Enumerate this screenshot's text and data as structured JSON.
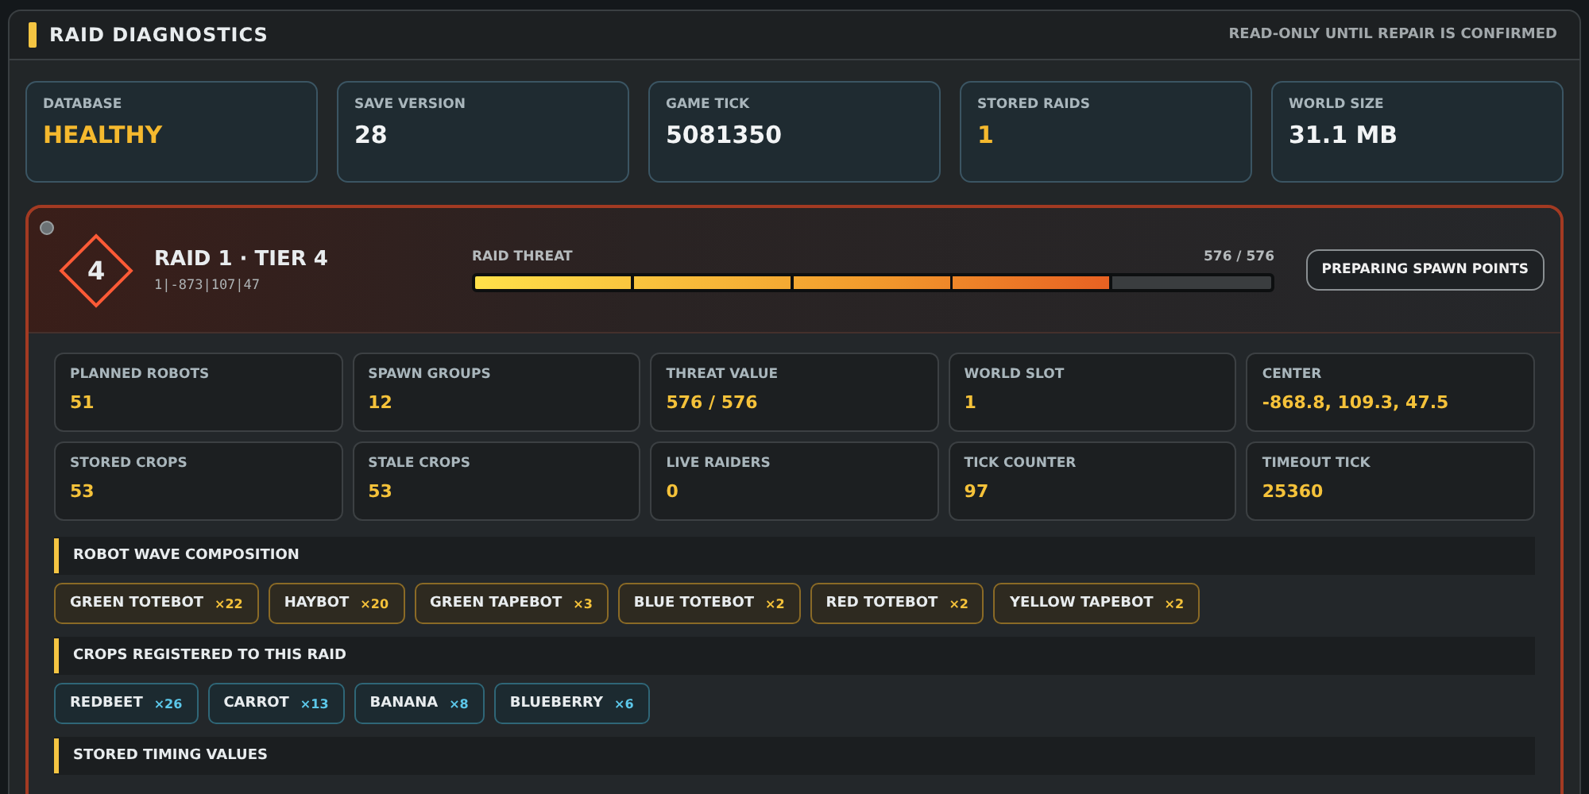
{
  "header": {
    "title": "RAID DIAGNOSTICS",
    "note": "READ-ONLY UNTIL REPAIR IS CONFIRMED"
  },
  "stats": [
    {
      "label": "DATABASE",
      "value": "HEALTHY",
      "highlight": true
    },
    {
      "label": "SAVE VERSION",
      "value": "28",
      "highlight": false
    },
    {
      "label": "GAME TICK",
      "value": "5081350",
      "highlight": false
    },
    {
      "label": "STORED RAIDS",
      "value": "1",
      "highlight": true
    },
    {
      "label": "WORLD SIZE",
      "value": "31.1 MB",
      "highlight": false
    }
  ],
  "raid": {
    "tier": "4",
    "title": "RAID 1 · TIER 4",
    "coords": "1|-873|107|47",
    "threat": {
      "label": "RAID THREAT",
      "reading": "576 / 576",
      "level": 0.8
    },
    "status": "PREPARING SPAWN POINTS",
    "stats": [
      {
        "label": "PLANNED ROBOTS",
        "value": "51"
      },
      {
        "label": "SPAWN GROUPS",
        "value": "12"
      },
      {
        "label": "THREAT VALUE",
        "value": "576 / 576"
      },
      {
        "label": "WORLD SLOT",
        "value": "1"
      },
      {
        "label": "CENTER",
        "value": "-868.8, 109.3, 47.5"
      },
      {
        "label": "STORED CROPS",
        "value": "53"
      },
      {
        "label": "STALE CROPS",
        "value": "53"
      },
      {
        "label": "LIVE RAIDERS",
        "value": "0"
      },
      {
        "label": "TICK COUNTER",
        "value": "97"
      },
      {
        "label": "TIMEOUT TICK",
        "value": "25360"
      }
    ],
    "sections": [
      {
        "title": "ROBOT WAVE COMPOSITION",
        "kind": "robot",
        "chips": [
          {
            "name": "GREEN TOTEBOT",
            "count": "×22"
          },
          {
            "name": "HAYBOT",
            "count": "×20"
          },
          {
            "name": "GREEN TAPEBOT",
            "count": "×3"
          },
          {
            "name": "BLUE TOTEBOT",
            "count": "×2"
          },
          {
            "name": "RED TOTEBOT",
            "count": "×2"
          },
          {
            "name": "YELLOW TAPEBOT",
            "count": "×2"
          }
        ]
      },
      {
        "title": "CROPS REGISTERED TO THIS RAID",
        "kind": "crop",
        "chips": [
          {
            "name": "REDBEET",
            "count": "×26"
          },
          {
            "name": "CARROT",
            "count": "×13"
          },
          {
            "name": "BANANA",
            "count": "×8"
          },
          {
            "name": "BLUEBERRY",
            "count": "×6"
          }
        ]
      },
      {
        "title": "STORED TIMING VALUES"
      }
    ]
  }
}
